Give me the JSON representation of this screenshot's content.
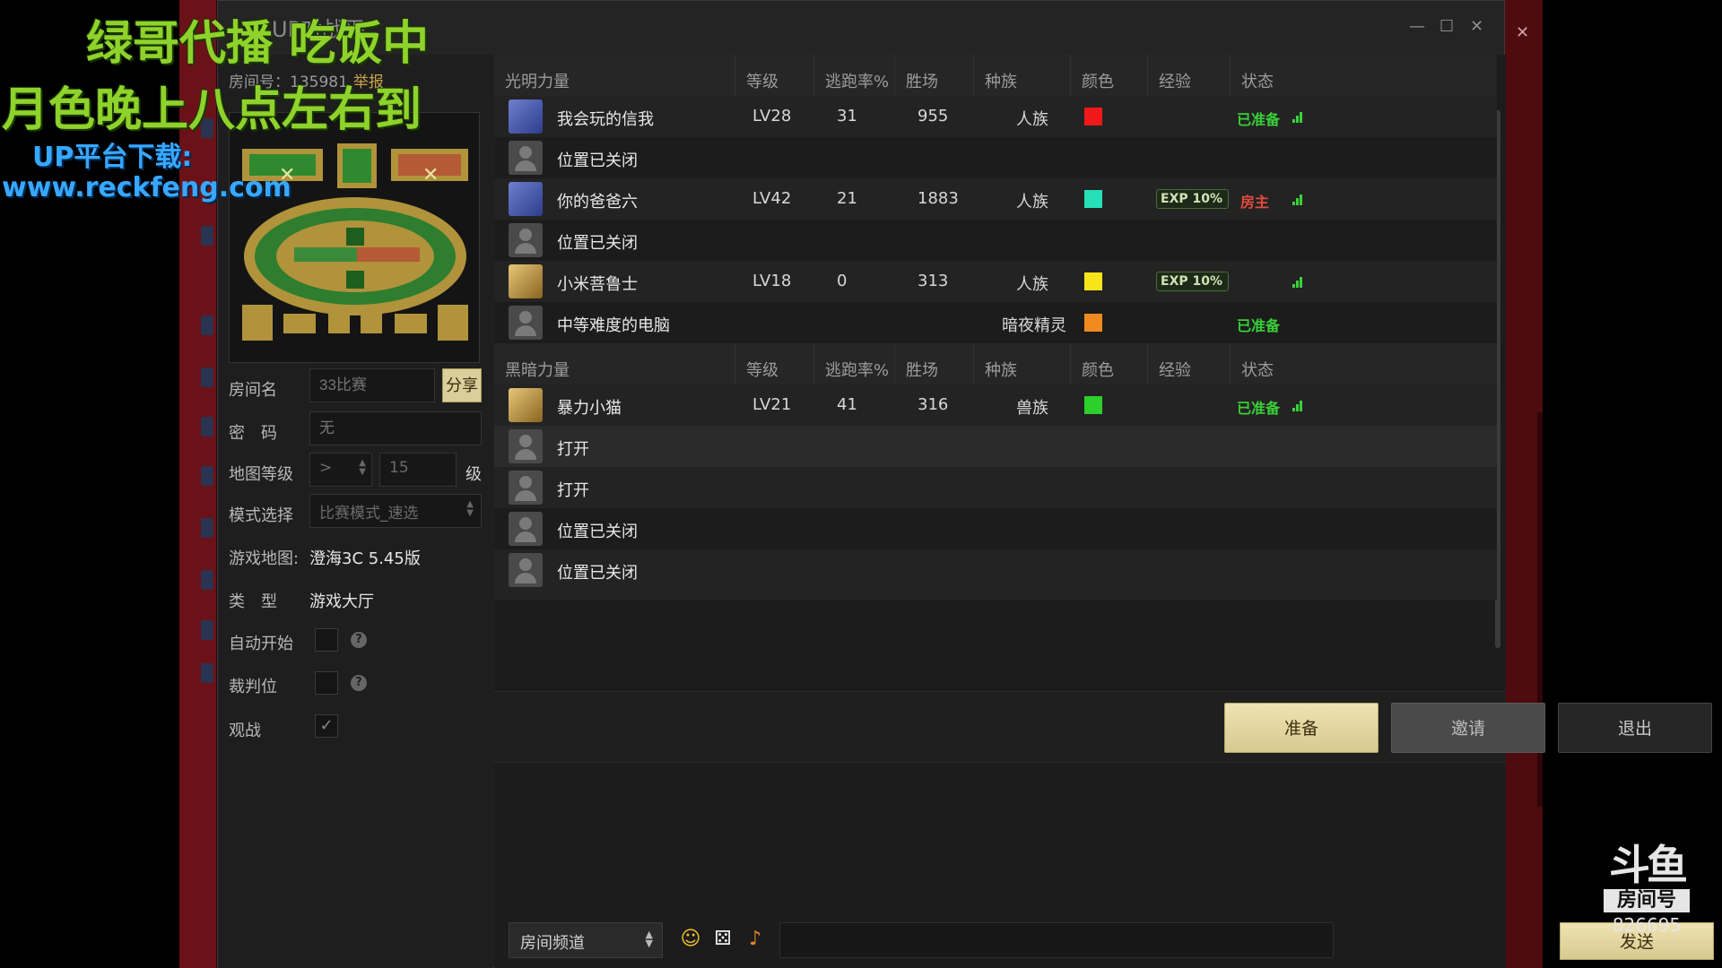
{
  "overlay": {
    "line1": "绿哥代播 吃饭中",
    "line2": "月色晚上八点左右到",
    "line3": "UP平台下载:",
    "line4": "www.reckfeng.com"
  },
  "window": {
    "title": "UP对战平"
  },
  "room": {
    "number_label": "房间号：135981",
    "report_label": "举报",
    "name_label": "房间名",
    "name_placeholder": "33比赛",
    "share_label": "分享",
    "password_label": "密　码",
    "password_placeholder": "无",
    "map_level_label": "地图等级",
    "map_level_op": ">",
    "map_level_value": "15",
    "map_level_unit": "级",
    "mode_label": "模式选择",
    "mode_value": "比赛模式_速选",
    "game_map_label": "游戏地图:",
    "game_map_value": "澄海3C 5.45版",
    "type_label": "类　型",
    "type_value": "游戏大厅",
    "auto_start_label": "自动开始",
    "referee_label": "裁判位",
    "spectate_label": "观战",
    "help_glyph": "?",
    "check_glyph": "✓"
  },
  "table": {
    "light_header": {
      "team": "光明力量",
      "level": "等级",
      "escape": "逃跑率%",
      "wins": "胜场",
      "race": "种族",
      "color": "颜色",
      "exp": "经验",
      "status": "状态"
    },
    "dark_header": {
      "team": "黑暗力量",
      "level": "等级",
      "escape": "逃跑率%",
      "wins": "胜场",
      "race": "种族",
      "color": "颜色",
      "exp": "经验",
      "status": "状态"
    },
    "exp_badge": "EXP 10%",
    "light_rows": [
      {
        "avatar": "blue",
        "name": "我会玩的信我",
        "level": "LV28",
        "escape": "31",
        "wins": "955",
        "race": "人族",
        "color": "#f01818",
        "exp": false,
        "status": "已准备",
        "status_type": "ready",
        "signal": true
      },
      {
        "avatar": "gray",
        "name": "位置已关闭",
        "level": "",
        "escape": "",
        "wins": "",
        "race": "",
        "color": "",
        "exp": false,
        "status": "",
        "status_type": "",
        "signal": false
      },
      {
        "avatar": "blue",
        "name": "你的爸爸六",
        "level": "LV42",
        "escape": "21",
        "wins": "1883",
        "race": "人族",
        "color": "#25e0b8",
        "exp": true,
        "status": "房主",
        "status_type": "host",
        "signal": true
      },
      {
        "avatar": "gray",
        "name": "位置已关闭",
        "level": "",
        "escape": "",
        "wins": "",
        "race": "",
        "color": "",
        "exp": false,
        "status": "",
        "status_type": "",
        "signal": false
      },
      {
        "avatar": "gold",
        "name": "小米菩鲁士",
        "level": "LV18",
        "escape": "0",
        "wins": "313",
        "race": "人族",
        "color": "#f7e51a",
        "exp": true,
        "status": "",
        "status_type": "",
        "signal": true
      },
      {
        "avatar": "gray",
        "name": "中等难度的电脑",
        "level": "",
        "escape": "",
        "wins": "",
        "race": "暗夜精灵",
        "color": "#f08a1e",
        "exp": false,
        "status": "已准备",
        "status_type": "ready",
        "signal": false
      }
    ],
    "dark_rows": [
      {
        "avatar": "gold",
        "name": "暴力小猫",
        "level": "LV21",
        "escape": "41",
        "wins": "316",
        "race": "兽族",
        "color": "#2bd02b",
        "exp": false,
        "status": "已准备",
        "status_type": "ready",
        "signal": true
      },
      {
        "avatar": "gray",
        "name": "打开",
        "level": "",
        "escape": "",
        "wins": "",
        "race": "",
        "color": "",
        "exp": false,
        "status": "",
        "status_type": "",
        "signal": false
      },
      {
        "avatar": "gray",
        "name": "打开",
        "level": "",
        "escape": "",
        "wins": "",
        "race": "",
        "color": "",
        "exp": false,
        "status": "",
        "status_type": "",
        "signal": false
      },
      {
        "avatar": "gray",
        "name": "位置已关闭",
        "level": "",
        "escape": "",
        "wins": "",
        "race": "",
        "color": "",
        "exp": false,
        "status": "",
        "status_type": "",
        "signal": false
      },
      {
        "avatar": "gray",
        "name": "位置已关闭",
        "level": "",
        "escape": "",
        "wins": "",
        "race": "",
        "color": "",
        "exp": false,
        "status": "",
        "status_type": "",
        "signal": false
      }
    ]
  },
  "actions": {
    "ready": "准备",
    "invite": "邀请",
    "exit": "退出"
  },
  "chat": {
    "channel": "房间频道",
    "send": "发送",
    "emoji_icon": "smiley-icon",
    "dice_icon": "dice-icon",
    "guitar_icon": "guitar-icon"
  },
  "douyu": {
    "logo": "斗鱼",
    "label": "房间号",
    "room_id": "826695"
  }
}
